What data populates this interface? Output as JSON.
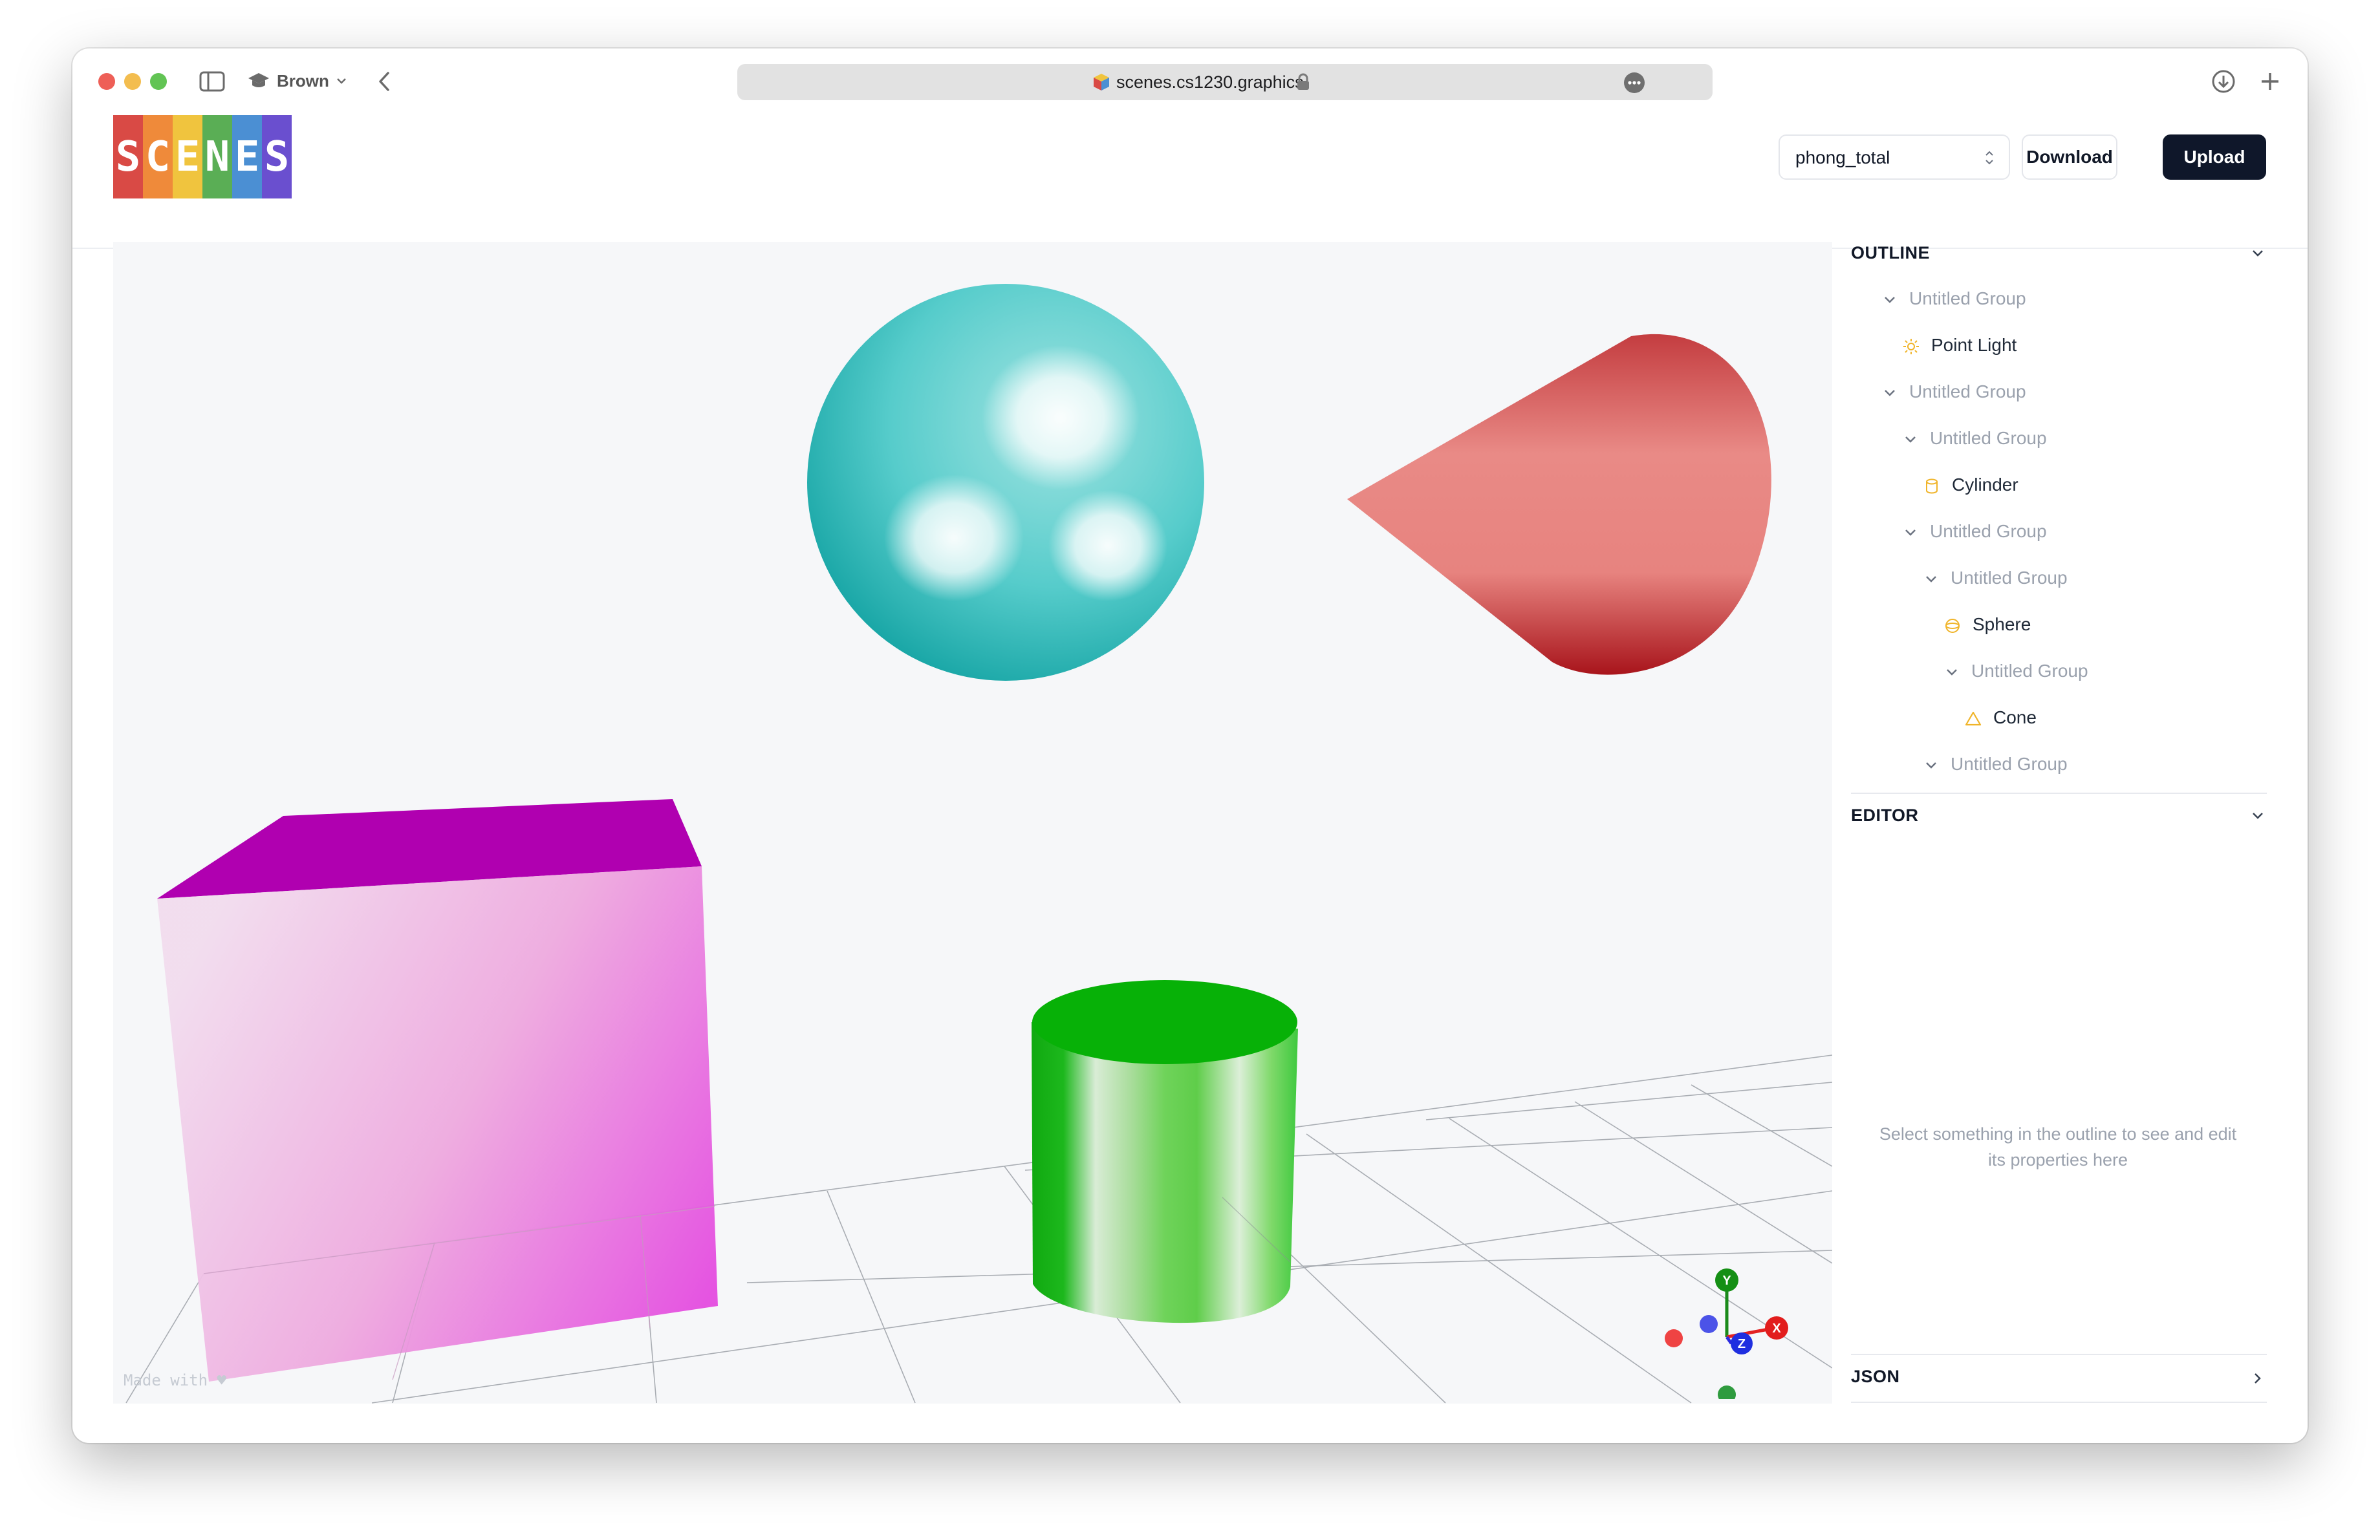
{
  "browser": {
    "profile_label": "Brown",
    "url": "scenes.cs1230.graphics"
  },
  "app": {
    "logo_letters": [
      "S",
      "C",
      "E",
      "N",
      "E",
      "S"
    ],
    "logo_colors": [
      "#d94a45",
      "#ef8a3a",
      "#f0c43e",
      "#5aae55",
      "#4b8fd3",
      "#6a4fcf"
    ]
  },
  "header": {
    "scene_select_value": "phong_total",
    "download_label": "Download",
    "upload_label": "Upload"
  },
  "viewport": {
    "watermark": "Made with ♥",
    "axes": {
      "y": "Y",
      "x": "X",
      "z": "Z"
    },
    "colors": {
      "sphere": "#2ebdbd",
      "cone": "#d9544f",
      "cube": "#e44ce0",
      "cylinder": "#17b717"
    }
  },
  "sidebar": {
    "outline_title": "OUTLINE",
    "outline": [
      {
        "label": "Untitled Group",
        "type": "group",
        "icon": "chevron-down-icon"
      },
      {
        "label": "Point Light",
        "type": "node",
        "icon": "sun-icon"
      },
      {
        "label": "Untitled Group",
        "type": "group",
        "icon": "chevron-down-icon"
      },
      {
        "label": "Untitled Group",
        "type": "group",
        "icon": "chevron-down-icon"
      },
      {
        "label": "Cylinder",
        "type": "node",
        "icon": "cylinder-icon"
      },
      {
        "label": "Untitled Group",
        "type": "group",
        "icon": "chevron-down-icon"
      },
      {
        "label": "Untitled Group",
        "type": "group",
        "icon": "chevron-down-icon"
      },
      {
        "label": "Sphere",
        "type": "node",
        "icon": "sphere-icon"
      },
      {
        "label": "Untitled Group",
        "type": "group",
        "icon": "chevron-down-icon"
      },
      {
        "label": "Cone",
        "type": "node",
        "icon": "cone-icon"
      },
      {
        "label": "Untitled Group",
        "type": "group",
        "icon": "chevron-down-icon"
      }
    ],
    "editor_title": "EDITOR",
    "editor_hint": "Select something in the outline to see and edit its properties here",
    "json_title": "JSON"
  }
}
